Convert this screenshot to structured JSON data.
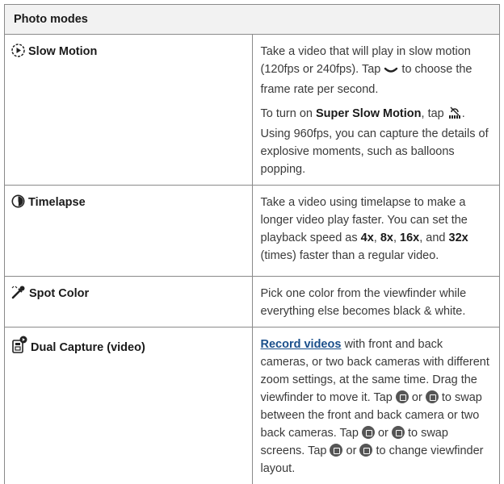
{
  "table": {
    "header": "Photo modes",
    "rows": {
      "slow_motion": {
        "label": "Slow Motion",
        "icon": "slow-motion-icon",
        "p1_a": "Take a video that will play in slow motion (120fps or 240fps). Tap ",
        "p1_b": " to choose the frame rate per second.",
        "p2_a": "To turn on ",
        "p2_bold": "Super Slow Motion",
        "p2_b": ", tap ",
        "p2_c": ". Using 960fps, you can capture the details of explosive moments, such as balloons popping."
      },
      "timelapse": {
        "label": "Timelapse",
        "icon": "timelapse-icon",
        "p1_a": "Take a video using timelapse to make a longer video play faster. You can set the playback speed as ",
        "s1": "4x",
        "sep1": ", ",
        "s2": "8x",
        "sep2": ", ",
        "s3": "16x",
        "sep3": ", and ",
        "s4": "32x",
        "p1_b": " (times) faster than a regular video."
      },
      "spot_color": {
        "label": "Spot Color",
        "icon": "spot-color-icon",
        "text": "Pick one color from the viewfinder while everything else becomes black & white."
      },
      "dual_capture": {
        "label": "Dual Capture (video)",
        "icon": "dual-capture-icon",
        "link": "Record videos",
        "t1": " with front and back cameras, or two back cameras with different zoom settings, at the same time. Drag the viewfinder to move it. Tap ",
        "or1": " or ",
        "t2": " to swap between the front and back camera or two back cameras. Tap ",
        "or2": " or ",
        "t3": " to swap screens. Tap ",
        "or3": " or ",
        "t4": " to change viewfinder layout."
      }
    }
  }
}
